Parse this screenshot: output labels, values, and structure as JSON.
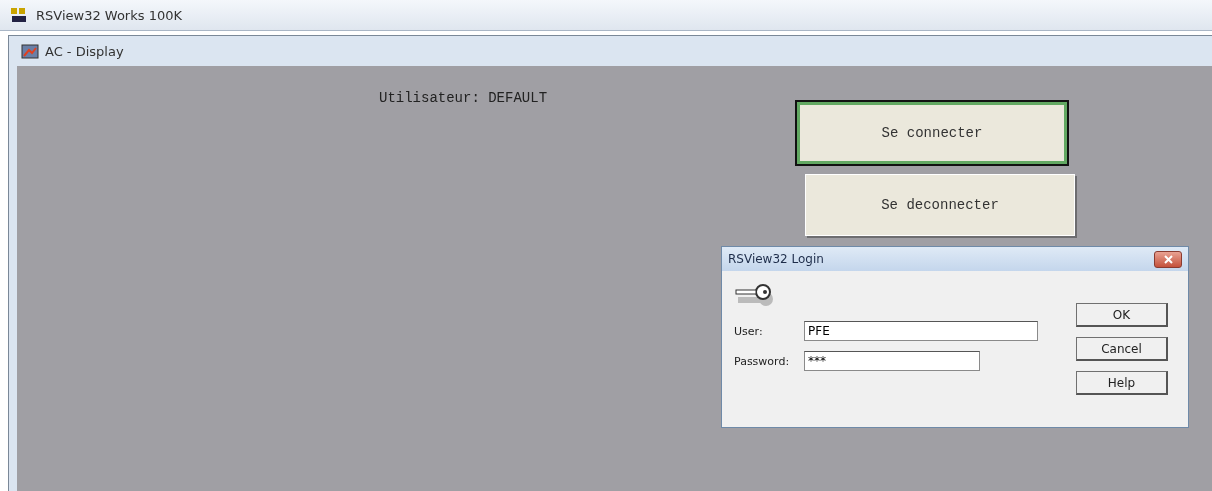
{
  "app_title": "RSView32 Works 100K",
  "child_window": {
    "title": "AC - Display"
  },
  "display": {
    "user_label": "Utilisateur: DEFAULT",
    "buttons": [
      {
        "label": "Se connecter",
        "focused": true
      },
      {
        "label": "Se deconnecter",
        "focused": false
      }
    ]
  },
  "dialog": {
    "title": "RSView32 Login",
    "fields": [
      {
        "label": "User:",
        "value": "PFE",
        "kind": "text"
      },
      {
        "label": "Password:",
        "value": "***",
        "kind": "password"
      }
    ],
    "buttons": [
      "OK",
      "Cancel",
      "Help"
    ]
  }
}
